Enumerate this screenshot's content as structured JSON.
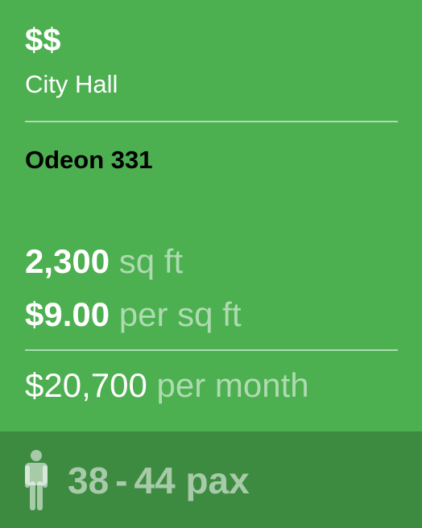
{
  "listing": {
    "price_tier": "$$",
    "location": "City Hall",
    "name": "Odeon 331",
    "area_value": "2,300",
    "area_unit": "sq ft",
    "rate_value": "$9.00",
    "rate_unit": "per sq ft",
    "monthly_value": "$20,700",
    "monthly_unit": "per month",
    "capacity_min": "38",
    "capacity_sep": "-",
    "capacity_max": "44 pax",
    "icon": "person-icon"
  },
  "colors": {
    "card_background": "#4caf50",
    "footer_background": "#3d8b40",
    "text_primary": "#ffffff",
    "text_dark": "#000000",
    "text_muted": "rgba(255,255,255,0.55)"
  }
}
